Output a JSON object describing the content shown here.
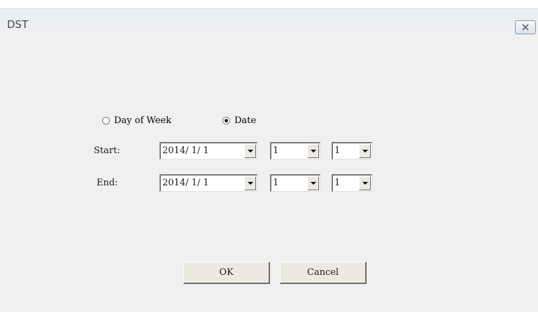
{
  "window": {
    "title": "DST",
    "close_icon": "close-icon"
  },
  "mode": {
    "options": [
      {
        "label": "Day of Week",
        "selected": false
      },
      {
        "label": "Date",
        "selected": true
      }
    ]
  },
  "start": {
    "label": "Start:",
    "date": "2014/ 1/ 1",
    "hour": "1",
    "minute": "1"
  },
  "end": {
    "label": "End:",
    "date": "2014/ 1/ 1",
    "hour": "1",
    "minute": "1"
  },
  "buttons": {
    "ok": "OK",
    "cancel": "Cancel"
  }
}
